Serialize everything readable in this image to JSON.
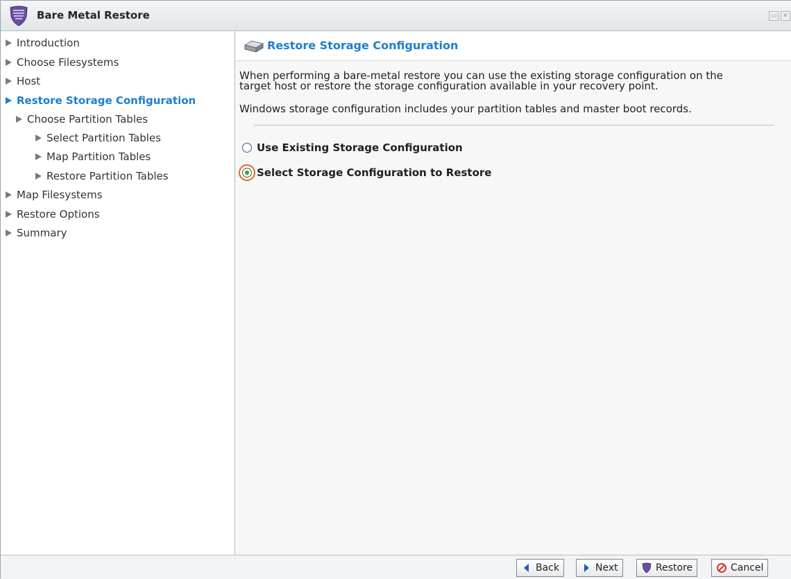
{
  "window": {
    "title": "Bare Metal Restore"
  },
  "sidebar": {
    "items": [
      {
        "label": "Introduction"
      },
      {
        "label": "Choose Filesystems"
      },
      {
        "label": "Host"
      },
      {
        "label": "Restore Storage Configuration"
      },
      {
        "label": "Choose Partition Tables"
      },
      {
        "label": "Select Partition Tables"
      },
      {
        "label": "Map Partition Tables"
      },
      {
        "label": "Restore Partition Tables"
      },
      {
        "label": "Map Filesystems"
      },
      {
        "label": "Restore Options"
      },
      {
        "label": "Summary"
      }
    ]
  },
  "panel": {
    "title": "Restore Storage Configuration",
    "description_line1": "When performing a bare-metal restore you can use the existing storage configuration on the",
    "description_line2": "target host or restore the storage configuration available in your recovery point.",
    "description_line3": "Windows storage configuration includes your partition tables and master boot records.",
    "options": [
      {
        "label": "Use Existing Storage Configuration",
        "selected": false
      },
      {
        "label": "Select Storage Configuration to Restore",
        "selected": true
      }
    ]
  },
  "footer": {
    "back_label": "Back",
    "next_label": "Next",
    "restore_label": "Restore",
    "cancel_label": "Cancel"
  },
  "colors": {
    "accent": "#1b7fd0",
    "selected_ring": "#e0662a"
  }
}
